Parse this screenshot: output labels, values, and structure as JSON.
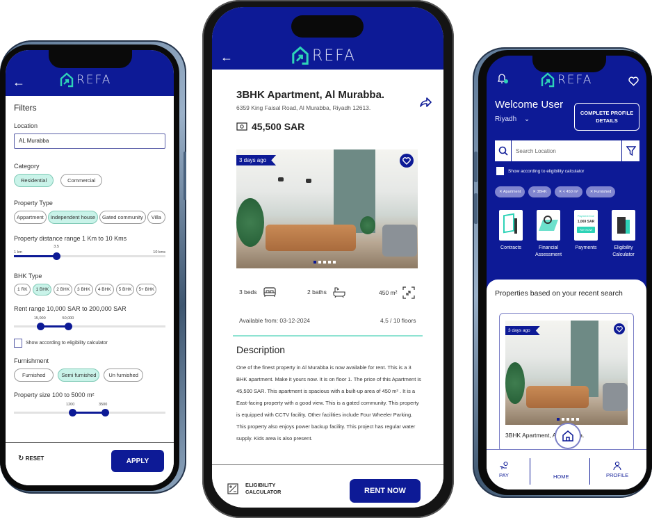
{
  "brand": {
    "name": "REFA",
    "primary_color": "#0d1a96",
    "accent_color": "#2ed3b7",
    "chip_selected_color": "#c9f3e9"
  },
  "filters_screen": {
    "title": "Filters",
    "location": {
      "label": "Location",
      "value": "AL Murabba"
    },
    "category": {
      "label": "Category",
      "options": [
        "Residential",
        "Commercial"
      ],
      "selected": "Residential"
    },
    "property_type": {
      "label": "Property Type",
      "options": [
        "Appartment",
        "Independent house",
        "Gated community",
        "Villa"
      ],
      "selected": "Independent house"
    },
    "distance": {
      "label": "Property distance range 1 Km to 10 Kms",
      "min_label": "1 km",
      "max_label": "10 kms",
      "min": 1,
      "max": 10,
      "value": 3.5,
      "value_label": "3.5"
    },
    "bhk": {
      "label": "BHK Type",
      "options": [
        "1 RK",
        "1 BHK",
        "2 BHK",
        "3 BHK",
        "4 BHK",
        "5 BHK",
        "5+ BHK"
      ],
      "selected": "1 BHK"
    },
    "rent": {
      "label": "Rent range 10,000 SAR to 200,000 SAR",
      "min": 10000,
      "max": 200000,
      "low": 15000,
      "high": 50000,
      "low_label": "15,000",
      "high_label": "50,000"
    },
    "eligibility_checkbox": {
      "label": "Show according to eligibility calculator",
      "checked": false
    },
    "furnishment": {
      "label": "Furnishment",
      "options": [
        "Furnished",
        "Semi furnished",
        "Un furnished"
      ],
      "selected": "Semi furnished"
    },
    "size": {
      "label": "Property size 100 to 5000 m²",
      "min": 100,
      "max": 5000,
      "low": 1200,
      "high": 3500,
      "low_label": "1200",
      "high_label": "3500"
    },
    "reset_label": "RESET",
    "apply_label": "APPLY"
  },
  "detail_screen": {
    "title": "3BHK Apartment, Al Murabba.",
    "address": "6359 King Faisal Road, Al Murabba, Riyadh 12613.",
    "price": "45,500 SAR",
    "badge": "3 days ago",
    "photo_count": 5,
    "photo_index": 1,
    "beds": "3 beds",
    "baths": "2 baths",
    "area": "450 m²",
    "available": "Available from: 03-12-2024",
    "floors": "4,5 / 10 floors",
    "description_title": "Description",
    "description": "One of the finest property in Al Murabba is now available for rent. This is a 3 BHK apartment. Make it yours now. It is on floor 1. The price of this Apartment is 45,500 SAR. This apartment is spacious with a built-up area of 450 m² . It is a East-facing property with a good view. This is a gated community. This property is equipped with CCTV facility. Other facilities include Four Wheeler Parking. This property also enjoys power backup facility. This project has regular water supply. Kids area is also present.",
    "eligibility_line1": "ELIGIBILITY",
    "eligibility_line2": "CALCULATOR",
    "rent_now_label": "RENT NOW"
  },
  "home_screen": {
    "welcome": "Welcome User",
    "city": "Riyadh",
    "complete_profile_line1": "COMPLETE PROFILE",
    "complete_profile_line2": "DETAILS",
    "search_placeholder": "Search Location",
    "eligibility_checkbox": "Show according to eligibility calculator",
    "tags": [
      "Apartment",
      "3BHK",
      "< 450 m²",
      "Furnished"
    ],
    "quick_actions": [
      {
        "label": "Contracts",
        "icon": "contract-illustration"
      },
      {
        "label": "Financial Assessment",
        "icon": "financial-illustration"
      },
      {
        "label": "Payments",
        "icon": "payment-card",
        "due_label": "Payment Due",
        "due_amount": "1,069 SAR",
        "pay_label": "PAY NOW"
      },
      {
        "label": "Eligibility Calculator",
        "icon": "eligibility-illustration"
      }
    ],
    "recent_title": "Properties based on your recent search",
    "card": {
      "badge": "3 days ago",
      "title": "3BHK Apartment, Al Murabba."
    },
    "tabs": [
      {
        "label": "PAY",
        "icon": "pay-icon"
      },
      {
        "label": "HOME",
        "icon": "home-icon"
      },
      {
        "label": "PROFILE",
        "icon": "profile-icon"
      }
    ],
    "active_tab": "HOME"
  }
}
